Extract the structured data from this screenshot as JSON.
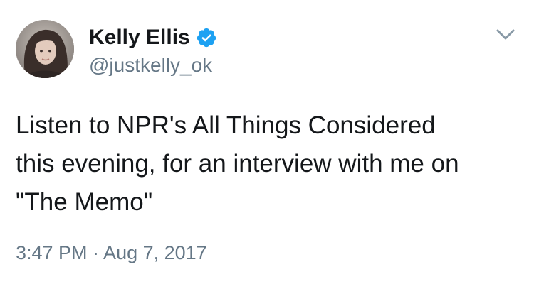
{
  "author": {
    "display_name": "Kelly Ellis",
    "handle": "@justkelly_ok",
    "verified": true
  },
  "tweet": {
    "text": "Listen to NPR's All Things Considered\nthis evening, for an interview with me on\n\"The Memo\"",
    "timestamp": "3:47 PM · Aug 7, 2017"
  },
  "icons": {
    "verified": "verified-badge-icon",
    "menu": "chevron-down-icon"
  },
  "colors": {
    "text_primary": "#14171a",
    "text_secondary": "#657786",
    "verified_blue": "#1da1f2"
  }
}
